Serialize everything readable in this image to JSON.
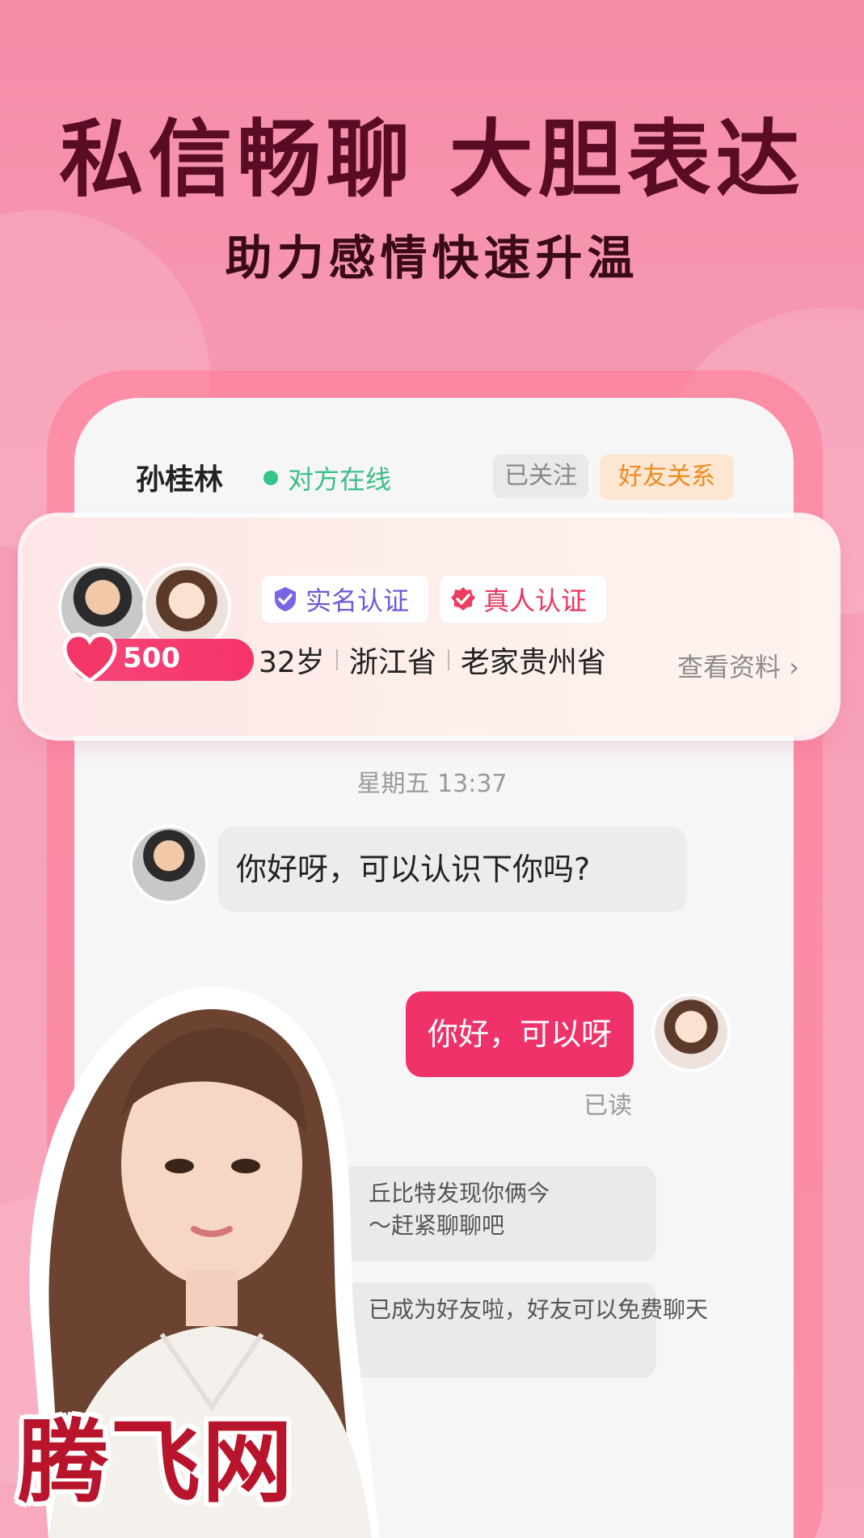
{
  "banner": {
    "headline": "私信畅聊 大胆表达",
    "subheadline": "助力感情快速升温"
  },
  "chat_header": {
    "contact_name": "孙桂林",
    "online_status": "对方在线",
    "followed_label": "已关注",
    "friend_label": "好友关系"
  },
  "profile_card": {
    "intimacy_value": "500",
    "badge_realname": "实名认证",
    "badge_realperson": "真人认证",
    "age": "32岁",
    "province": "浙江省",
    "hometown": "老家贵州省",
    "view_profile": "查看资料 ›"
  },
  "chat": {
    "timestamp": "星期五 13:37",
    "incoming_message": "你好呀，可以认识下你吗?",
    "outgoing_message": "你好，可以呀",
    "read_status": "已读",
    "system_line1_a": "丘比特发现你俩今",
    "system_line1_b": "～赶紧聊聊吧",
    "system_line2": "已成为好友啦，好友可以免费聊天"
  },
  "watermark": "腾飞网",
  "colors": {
    "accent_pink": "#f0326a",
    "online_green": "#35c48a",
    "friend_orange": "#f08a1e",
    "verify_purple": "#6e5ad8"
  }
}
